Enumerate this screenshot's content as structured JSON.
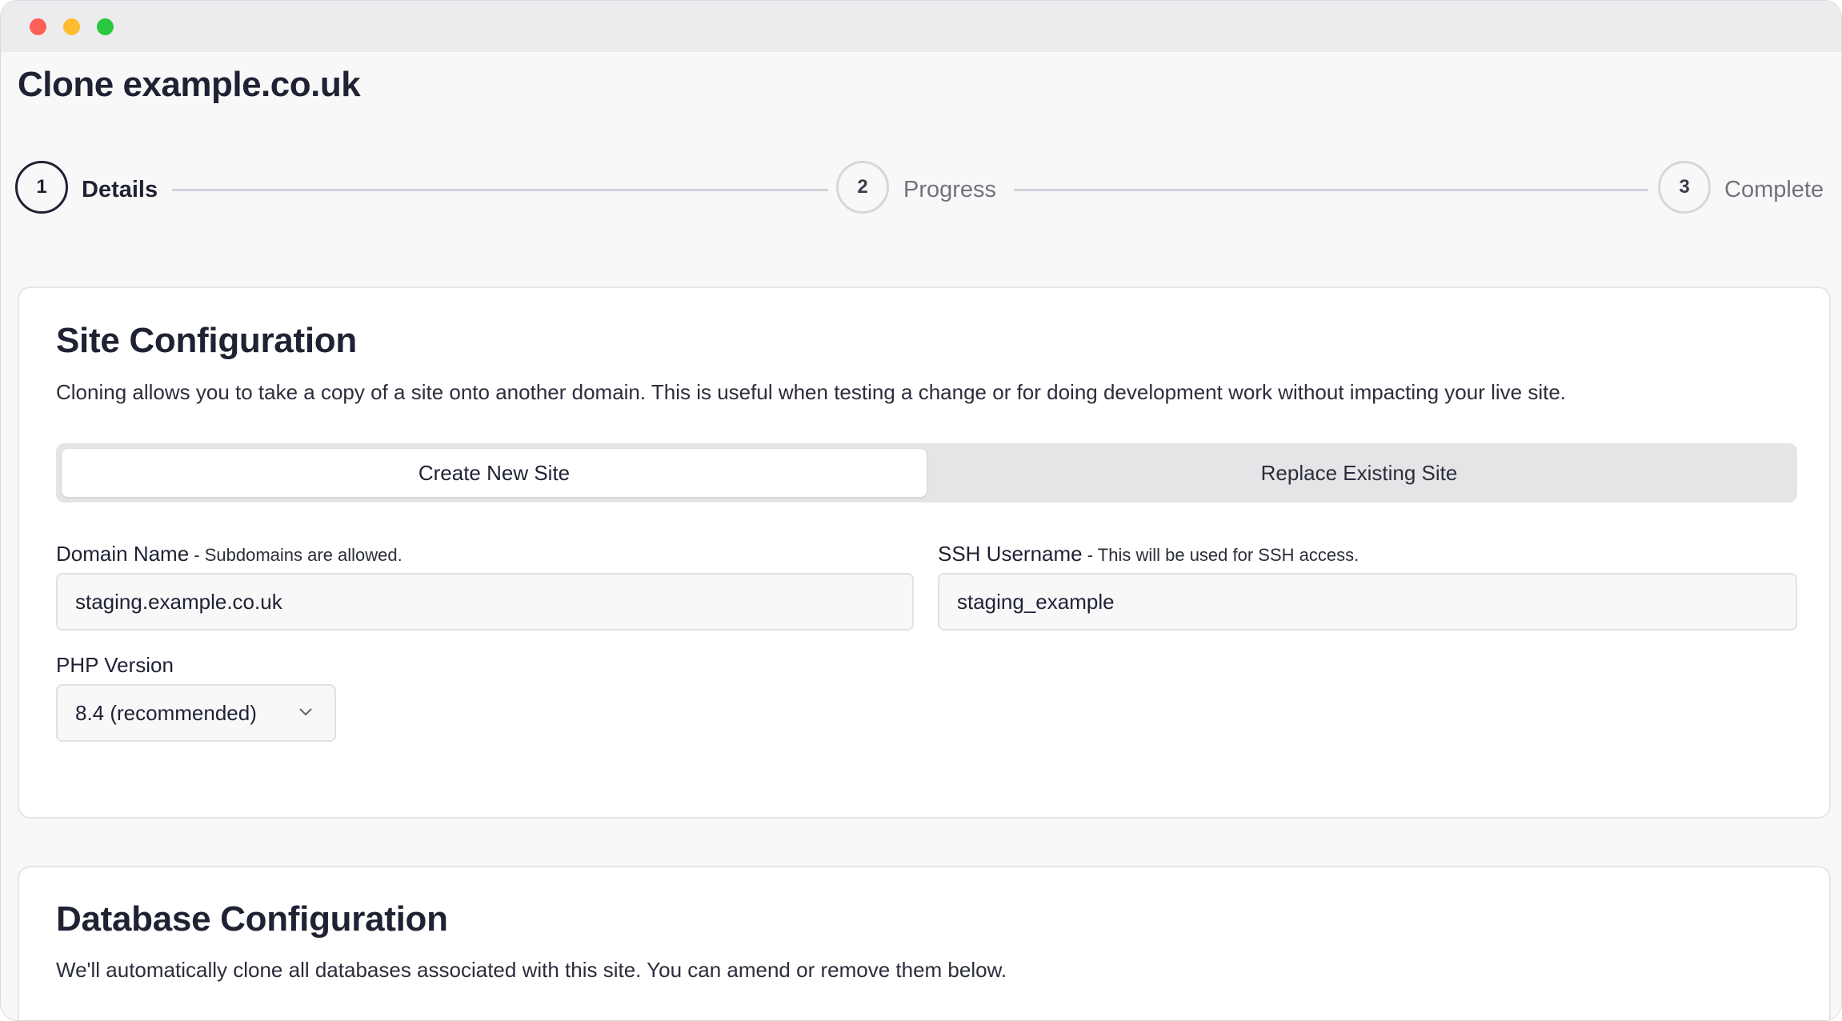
{
  "window": {
    "controls": [
      "close",
      "minimize",
      "zoom"
    ]
  },
  "page": {
    "title": "Clone example.co.uk"
  },
  "stepper": {
    "steps": [
      {
        "number": "1",
        "label": "Details",
        "state": "active"
      },
      {
        "number": "2",
        "label": "Progress",
        "state": "inactive"
      },
      {
        "number": "3",
        "label": "Complete",
        "state": "inactive"
      }
    ]
  },
  "site_config": {
    "title": "Site Configuration",
    "description": "Cloning allows you to take a copy of a site onto another domain. This is useful when testing a change or for doing development work without impacting your live site.",
    "mode_toggle": {
      "options": [
        "Create New Site",
        "Replace Existing Site"
      ],
      "selected": "Create New Site"
    },
    "domain": {
      "label": "Domain Name",
      "hint": " - Subdomains are allowed.",
      "value": "staging.example.co.uk"
    },
    "ssh": {
      "label": "SSH Username",
      "hint": " - This will be used for SSH access.",
      "value": "staging_example"
    },
    "php": {
      "label": "PHP Version",
      "value": "8.4 (recommended)",
      "icon": "chevron-down-icon"
    }
  },
  "database_config": {
    "title": "Database Configuration",
    "description": "We'll automatically clone all databases associated with this site. You can amend or remove them below."
  },
  "colors": {
    "primary_text": "#1f2233",
    "close": "#fe5f57",
    "minimize": "#febc2e",
    "zoom": "#28c840"
  }
}
